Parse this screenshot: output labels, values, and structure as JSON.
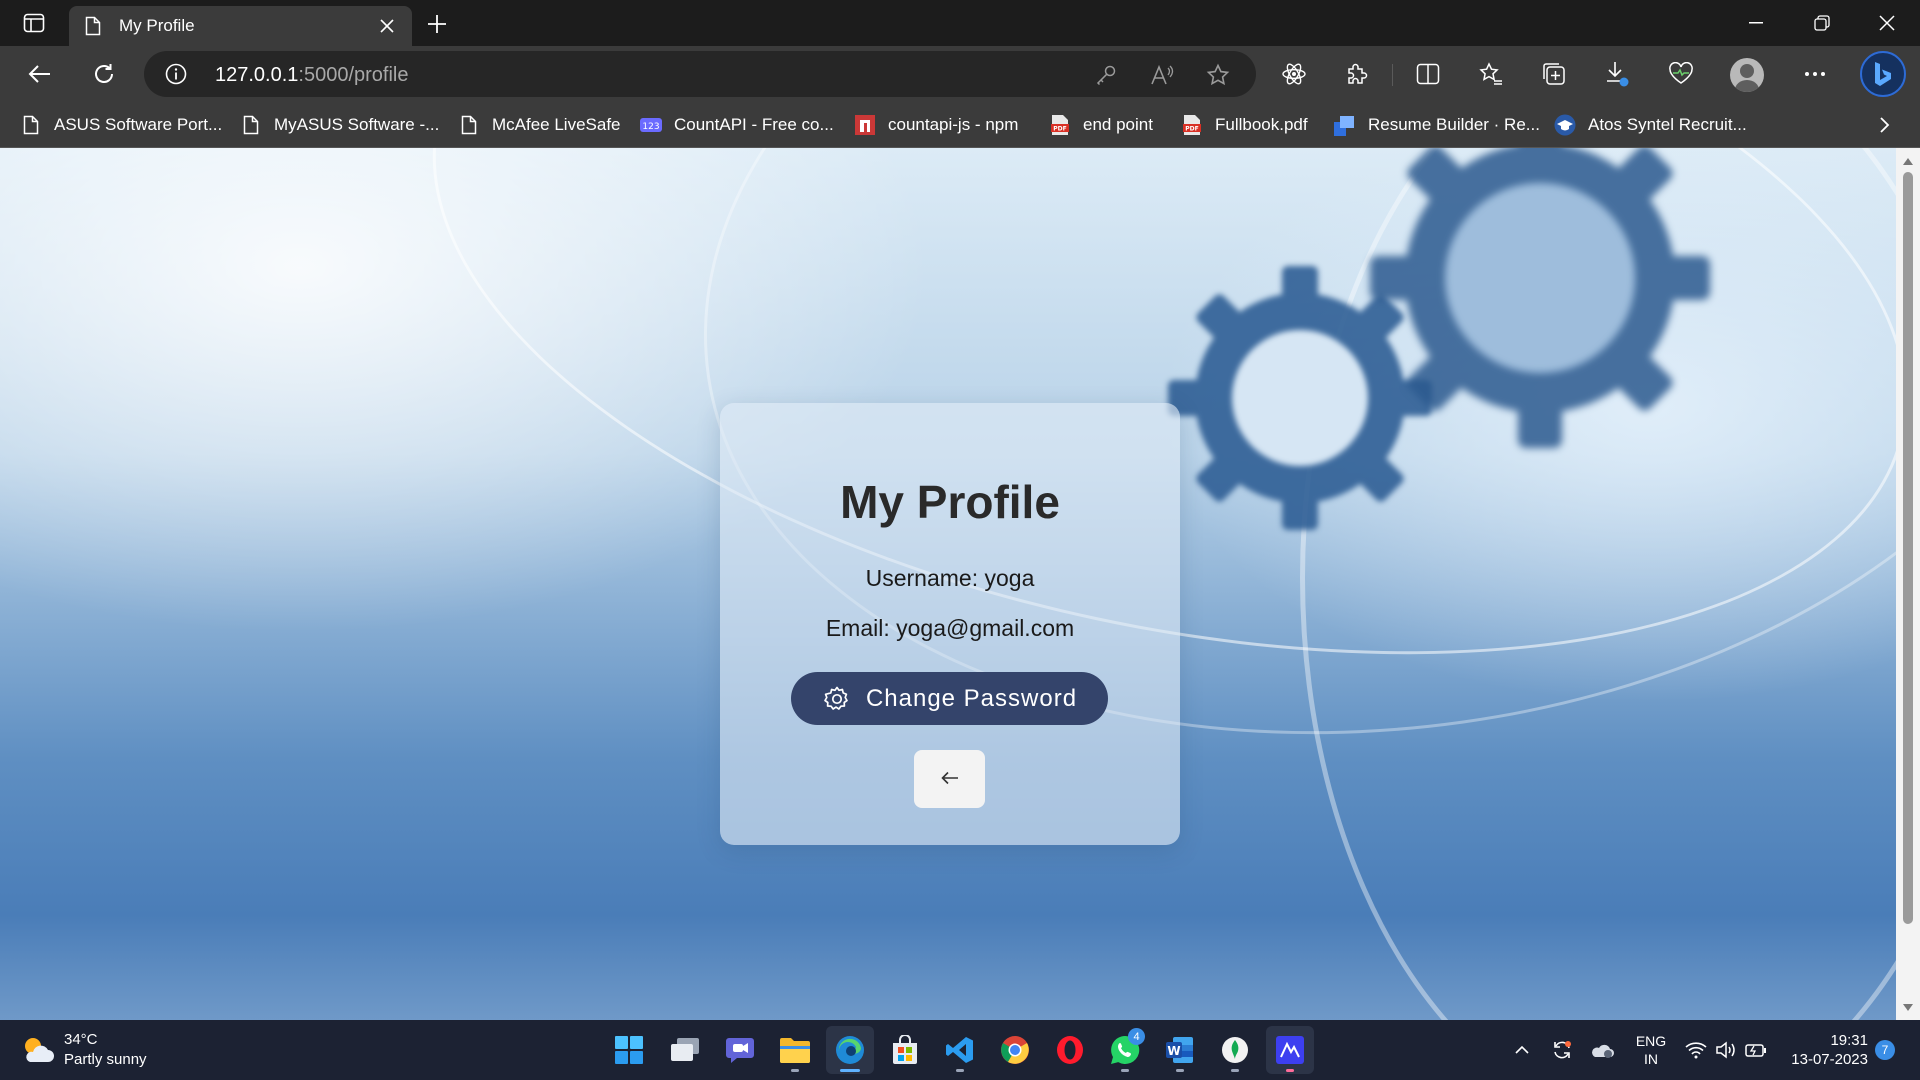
{
  "browser": {
    "tab": {
      "title": "My Profile"
    },
    "address": {
      "host": "127.0.0.1",
      "path": ":5000/profile"
    },
    "bookmarks": [
      {
        "label": "ASUS Software Port...",
        "icon": "page-icon"
      },
      {
        "label": "MyASUS Software -...",
        "icon": "page-icon"
      },
      {
        "label": "McAfee LiveSafe",
        "icon": "page-icon"
      },
      {
        "label": "CountAPI - Free co...",
        "icon": "countapi-icon"
      },
      {
        "label": "countapi-js - npm",
        "icon": "npm-icon"
      },
      {
        "label": "end point",
        "icon": "pdf-icon"
      },
      {
        "label": "Fullbook.pdf",
        "icon": "pdf-icon"
      },
      {
        "label": "Resume Builder · Re...",
        "icon": "resume-icon"
      },
      {
        "label": "Atos Syntel Recruit...",
        "icon": "graduation-cap-icon"
      }
    ]
  },
  "profile": {
    "title": "My Profile",
    "username": "Username: yoga",
    "email": "Email: yoga@gmail.com",
    "change_password_label": "Change Password",
    "back_icon": "arrow-left-icon"
  },
  "taskbar": {
    "weather": {
      "temp": "34°C",
      "condition": "Partly sunny"
    },
    "whatsapp_badge": "4",
    "lang": {
      "line1": "ENG",
      "line2": "IN"
    },
    "clock": {
      "time": "19:31",
      "date": "13-07-2023"
    },
    "notifications": "7"
  },
  "colors": {
    "card_button": "#34446b",
    "taskbar": "#1c2233",
    "browser_chrome": "#3b3b3b"
  }
}
